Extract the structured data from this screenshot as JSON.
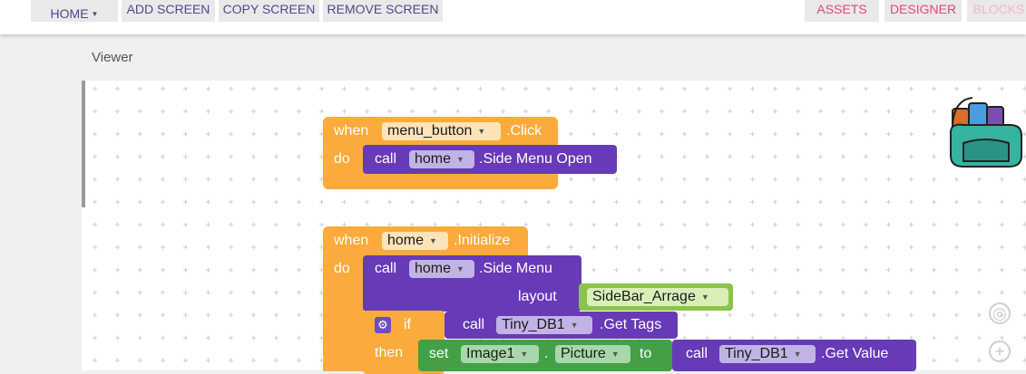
{
  "toolbar": {
    "home_label": "HOME",
    "add_screen": "ADD SCREEN",
    "copy_screen": "COPY SCREEN",
    "remove_screen": "REMOVE SCREEN",
    "assets": "ASSETS",
    "designer": "DESIGNER",
    "blocks": "BLOCKS"
  },
  "viewer": {
    "title": "Viewer"
  },
  "block1": {
    "when": "when",
    "component": "menu_button",
    "event": ".Click",
    "do": "do",
    "call": "call",
    "target": "home",
    "method": ".Side Menu Open"
  },
  "block2": {
    "when": "when",
    "component": "home",
    "event": ".Initialize",
    "do": "do",
    "call": "call",
    "target": "home",
    "method": ".Side Menu",
    "param_label": "layout",
    "param_value": "SideBar_Arrage",
    "if_label": "if",
    "if_call": "call",
    "if_target": "Tiny_DB1",
    "if_method": ".Get Tags",
    "then_label": "then",
    "set_label": "set",
    "set_component": "Image1",
    "dot": ".",
    "set_property": "Picture",
    "to_label": "to",
    "value_call": "call",
    "value_target": "Tiny_DB1",
    "value_method": ".Get Value"
  },
  "colors": {
    "event_block": "#fbab3b",
    "procedure_block": "#673ab7",
    "set_block": "#43a047",
    "text_block": "#8bc34a",
    "accent_pink": "#e0477d"
  }
}
